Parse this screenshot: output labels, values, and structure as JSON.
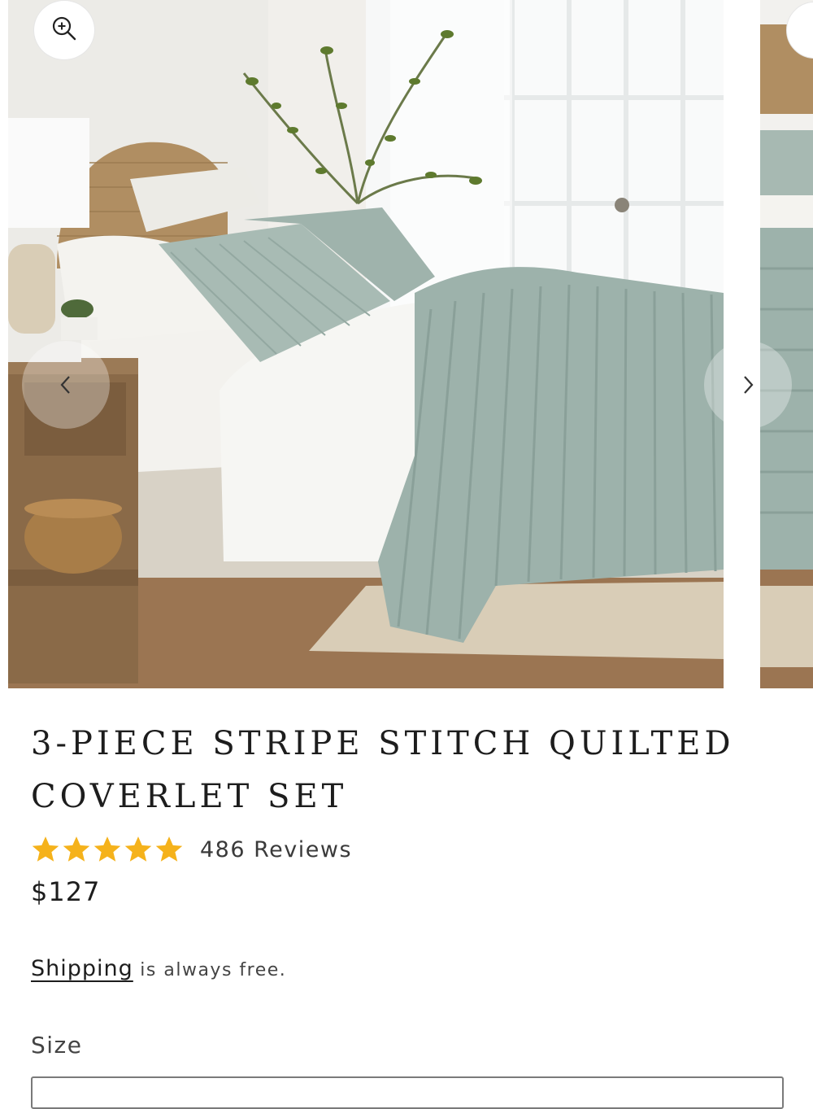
{
  "product": {
    "title": "3-Piece Stripe Stitch Quilted Coverlet Set",
    "rating": 5,
    "rating_max": 5,
    "reviews_label": "486 Reviews",
    "price": "$127",
    "shipping_link": "Shipping",
    "shipping_text": " is always free.",
    "size_label": "Size"
  },
  "icons": {
    "zoom": "zoom-in-icon",
    "prev": "chevron-left-icon",
    "next": "chevron-right-icon",
    "star": "star-icon"
  },
  "colors": {
    "star": "#F5B21B",
    "coverlet": "#9DB2AB",
    "text": "#1D1D1D"
  }
}
